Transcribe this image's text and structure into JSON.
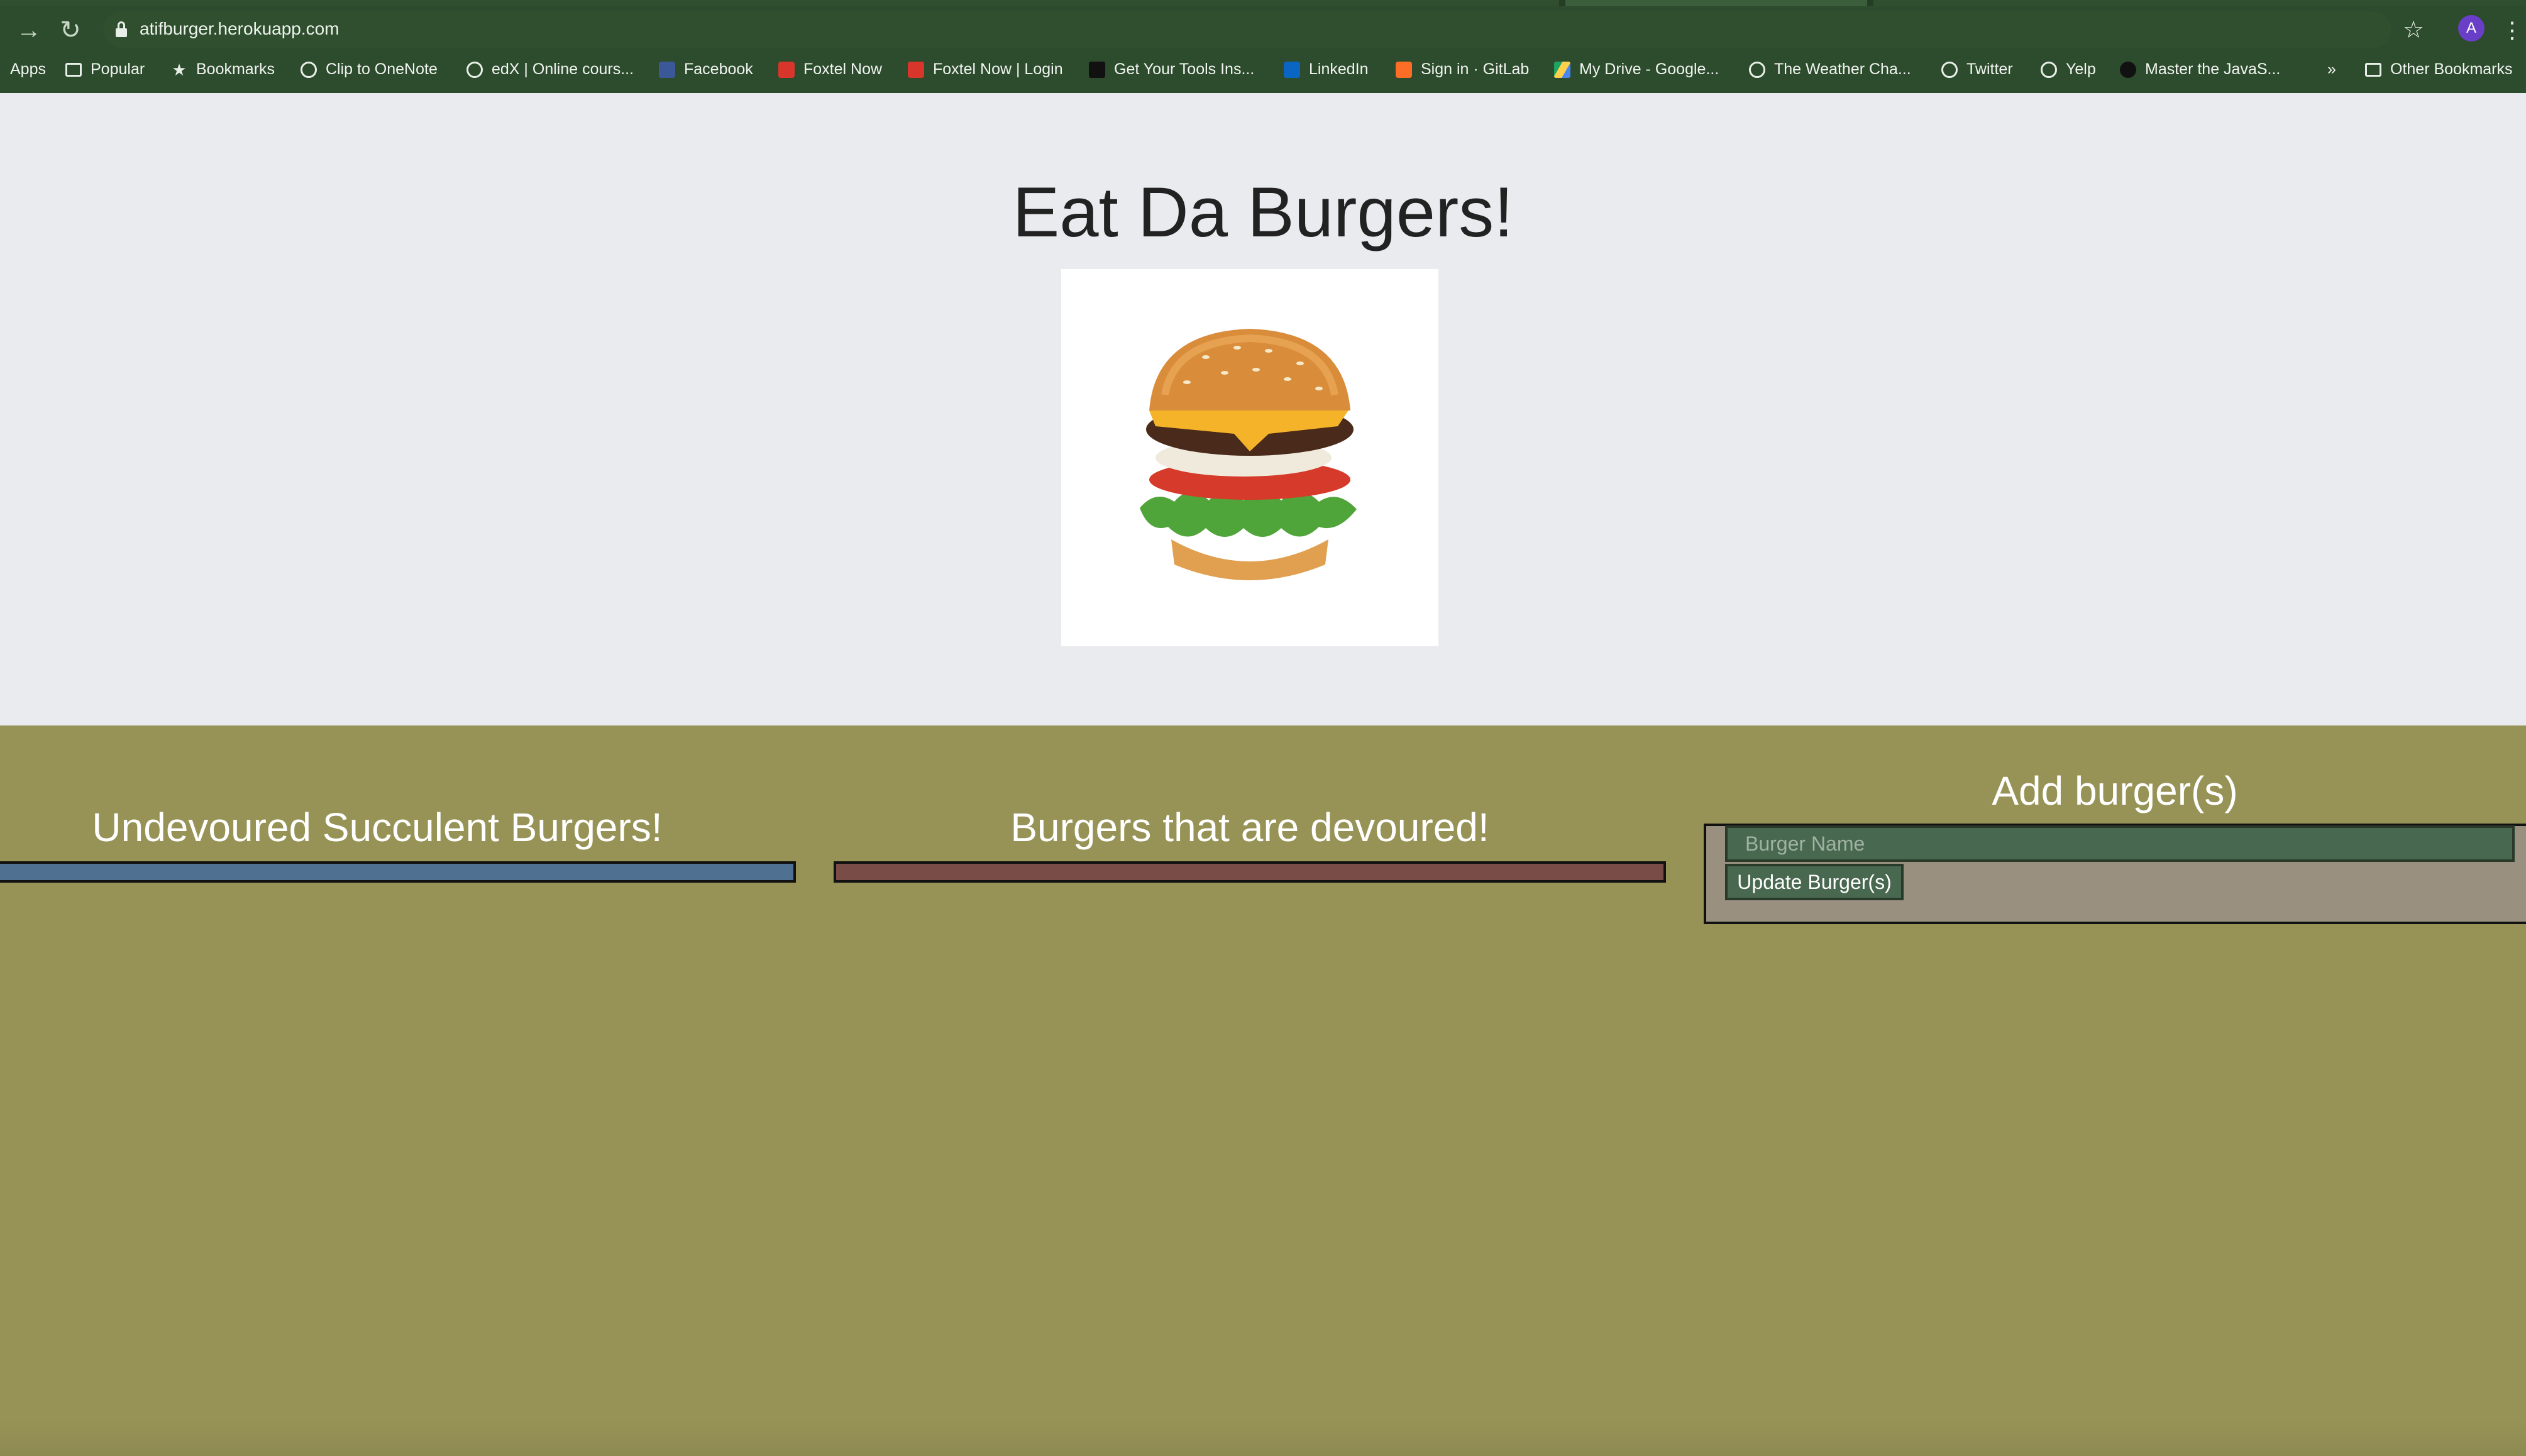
{
  "browser": {
    "url": "atifburger.herokuapp.com",
    "profile_initial": "A",
    "bookmarks": [
      {
        "label": "Apps",
        "icon": "apps-icon"
      },
      {
        "label": "Popular",
        "icon": "folder-icon"
      },
      {
        "label": "Bookmarks",
        "icon": "star-icon"
      },
      {
        "label": "Clip to OneNote",
        "icon": "globe-icon"
      },
      {
        "label": "edX | Online cours...",
        "icon": "globe-icon"
      },
      {
        "label": "Facebook",
        "icon": "facebook-icon"
      },
      {
        "label": "Foxtel Now",
        "icon": "foxtel-icon"
      },
      {
        "label": "Foxtel Now | Login",
        "icon": "foxtel-icon"
      },
      {
        "label": "Get Your Tools Ins...",
        "icon": "book-icon"
      },
      {
        "label": "LinkedIn",
        "icon": "linkedin-icon"
      },
      {
        "label": "Sign in · GitLab",
        "icon": "gitlab-icon"
      },
      {
        "label": "My Drive - Google...",
        "icon": "drive-icon"
      },
      {
        "label": "The Weather Cha...",
        "icon": "globe-icon"
      },
      {
        "label": "Twitter",
        "icon": "globe-icon"
      },
      {
        "label": "Yelp",
        "icon": "globe-icon"
      },
      {
        "label": "Master the JavaS...",
        "icon": "medium-icon"
      }
    ],
    "overflow_label": "»",
    "other_bookmarks": "Other Bookmarks"
  },
  "page": {
    "title": "Eat Da Burgers!",
    "image_icon": "burger-image"
  },
  "columns": {
    "undevoured": {
      "title": "Undevoured Succulent Burgers!",
      "color": "#4f7090"
    },
    "devoured": {
      "title": "Burgers that are devoured!",
      "color": "#7a4c48"
    },
    "add": {
      "title": "Add burger(s)",
      "placeholder": "Burger Name",
      "button": "Update Burger(s)"
    }
  },
  "colors": {
    "background": "#979356",
    "jumbotron": "#e9ebef",
    "chrome": "#2d4b2d",
    "accent_green": "#496850"
  }
}
